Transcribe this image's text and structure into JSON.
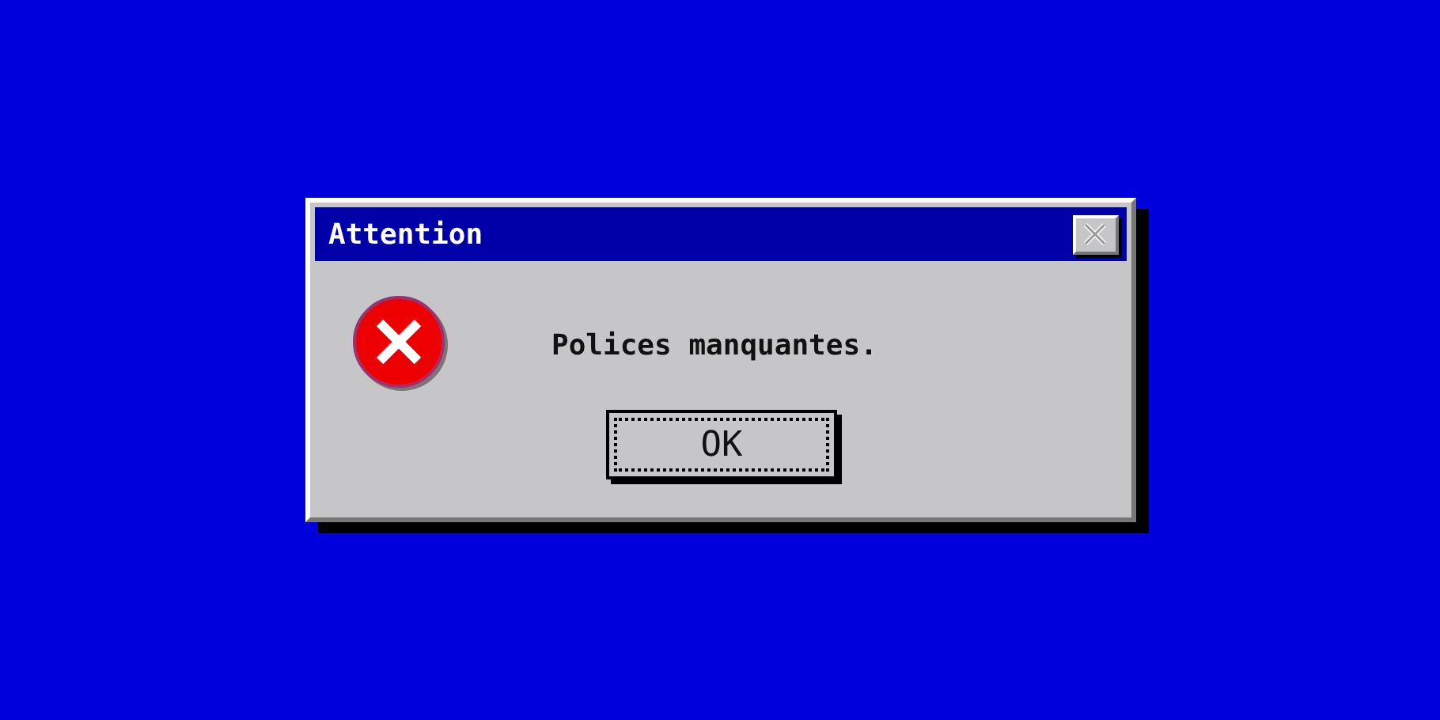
{
  "window": {
    "title": "Attention"
  },
  "message": "Polices manquantes.",
  "buttons": [
    {
      "label": "OK",
      "focused": true
    }
  ]
}
